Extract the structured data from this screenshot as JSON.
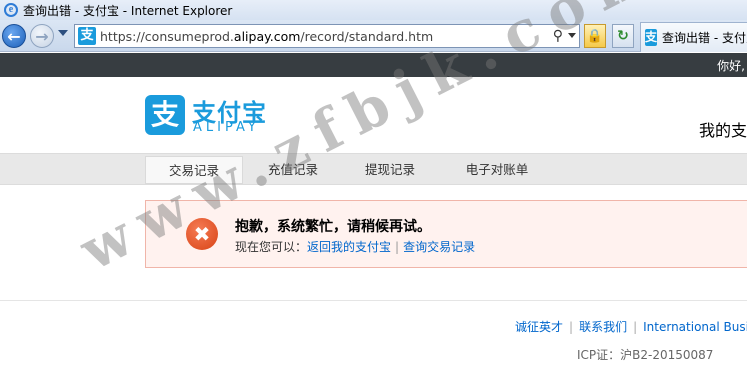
{
  "browser": {
    "window_title": "查询出错 - 支付宝 - Internet Explorer",
    "url_prefix": "https://consumeprod.",
    "url_domain": "alipay.com",
    "url_path": "/record/standard.htm",
    "tab_title": "查询出错 - 支付宝"
  },
  "topbar": {
    "greeting": "你好,"
  },
  "header": {
    "logo_mark": "支",
    "logo_cn": "支付宝",
    "logo_en": "ALIPAY",
    "my_alipay": "我的支"
  },
  "subnav": {
    "items": [
      {
        "label": "交易记录"
      },
      {
        "label": "充值记录"
      },
      {
        "label": "提现记录"
      },
      {
        "label": "电子对账单"
      }
    ]
  },
  "error": {
    "title": "抱歉，系统繁忙，请稍候再试。",
    "now_you_can": "现在您可以：",
    "link_back": "返回我的支付宝",
    "separator": "|",
    "link_records": "查询交易记录"
  },
  "footer": {
    "links": [
      "诚征英才",
      "联系我们",
      "International Business"
    ],
    "separator": "|",
    "icp": "ICP证：沪B2-20150087"
  },
  "watermark": "www.zfbjk.com",
  "colors": {
    "brand": "#1a9bdc",
    "topbar": "#373d41",
    "error_bg": "#fff2ef",
    "error_border": "#f0b5a9",
    "link": "#0066cc"
  },
  "icons": {
    "back": "back-arrow-icon",
    "forward": "forward-arrow-icon",
    "search": "search-icon",
    "lock": "lock-icon",
    "refresh": "refresh-icon",
    "error": "error-x-icon"
  }
}
